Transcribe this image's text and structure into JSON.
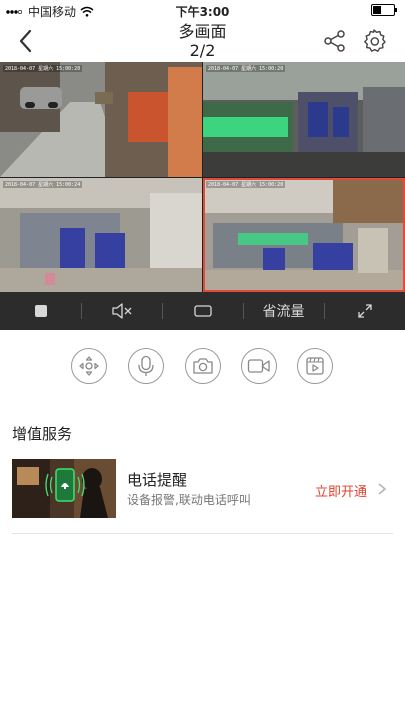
{
  "status_bar": {
    "carrier": "中国移动",
    "time": "下午3:00"
  },
  "nav": {
    "title": "多画面",
    "page": "2/2"
  },
  "cameras": [
    {
      "timestamp": "2018-04-07 星期六 15:00:20"
    },
    {
      "timestamp": "2018-04-07 星期六 15:00:20"
    },
    {
      "timestamp": "2018-04-07 星期六 15:00:24"
    },
    {
      "timestamp": "2018-04-07 星期六 15:00:20"
    }
  ],
  "controls": {
    "data_saver_label": "省流量"
  },
  "services": {
    "section_title": "增值服务",
    "item": {
      "name": "电话提醒",
      "description": "设备报警,联动电话呼叫",
      "action": "立即开通"
    }
  },
  "colors": {
    "accent": "#e0412f",
    "control_bar": "#2c2c2c"
  }
}
